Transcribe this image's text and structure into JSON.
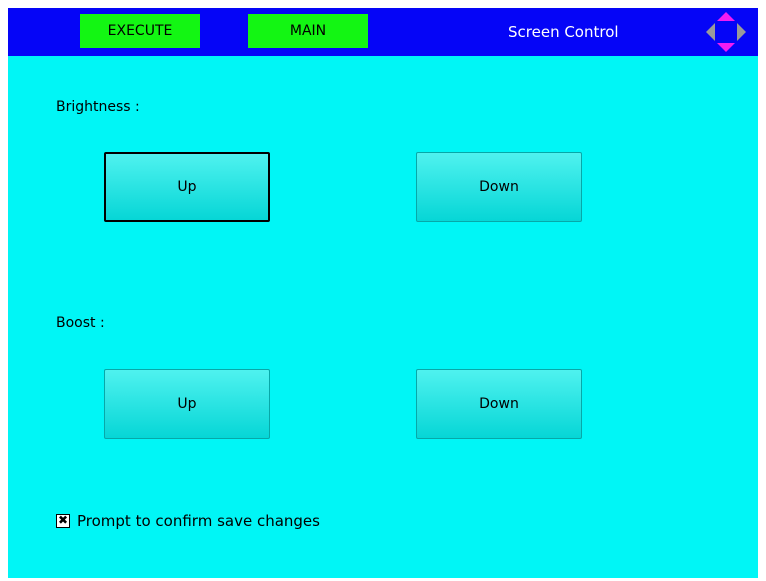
{
  "header": {
    "execute_label": "EXECUTE",
    "main_label": "MAIN",
    "title": "Screen Control",
    "nav_icon": "dpad-arrows-icon"
  },
  "brightness": {
    "label": "Brightness :",
    "up_label": "Up",
    "down_label": "Down"
  },
  "boost": {
    "label": "Boost :",
    "up_label": "Up",
    "down_label": "Down"
  },
  "confirm_save": {
    "label": "Prompt to confirm save changes",
    "checked": true,
    "mark": "✖"
  },
  "colors": {
    "background": "#00f6f6",
    "header": "#0505f7",
    "nav_button": "#13f613",
    "dpad_vertical": "#f21cf2",
    "dpad_horizontal": "#9a9a9a"
  }
}
